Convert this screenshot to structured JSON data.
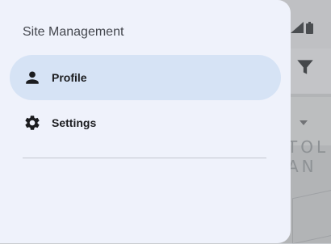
{
  "drawer": {
    "headline": "Site Management",
    "items": [
      {
        "label": "Profile",
        "icon": "person-icon",
        "active": true
      },
      {
        "label": "Settings",
        "icon": "gear-icon",
        "active": false
      }
    ]
  },
  "background": {
    "map_label": "TOL\nAN"
  },
  "colors": {
    "drawer_bg": "#eff2fb",
    "active_pill": "#d6e3f5",
    "text": "#1b1c1f"
  }
}
